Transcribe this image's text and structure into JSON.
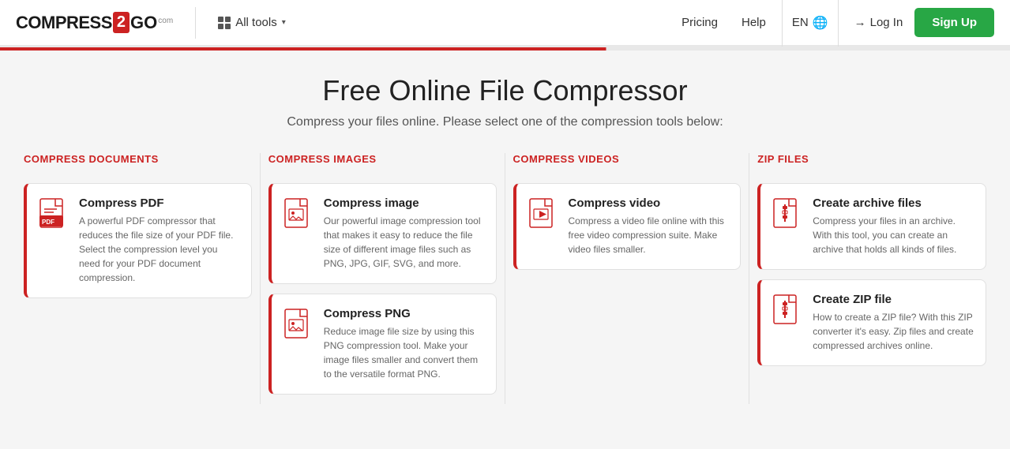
{
  "header": {
    "logo": {
      "part1": "COMPRESS",
      "part2": "2",
      "part3": "GO",
      "suffix": "com"
    },
    "allTools": "All tools",
    "nav": {
      "pricing": "Pricing",
      "help": "Help",
      "lang": "EN",
      "login": "Log In",
      "signup": "Sign Up"
    }
  },
  "page": {
    "title": "Free Online File Compressor",
    "subtitle": "Compress your files online. Please select one of the compression tools below:"
  },
  "columns": [
    {
      "header": "COMPRESS DOCUMENTS",
      "tools": [
        {
          "title": "Compress PDF",
          "desc": "A powerful PDF compressor that reduces the file size of your PDF file. Select the compression level you need for your PDF document compression.",
          "iconType": "pdf"
        }
      ]
    },
    {
      "header": "COMPRESS IMAGES",
      "tools": [
        {
          "title": "Compress image",
          "desc": "Our powerful image compression tool that makes it easy to reduce the file size of different image files such as PNG, JPG, GIF, SVG, and more.",
          "iconType": "img"
        },
        {
          "title": "Compress PNG",
          "desc": "Reduce image file size by using this PNG compression tool. Make your image files smaller and convert them to the versatile format PNG.",
          "iconType": "img"
        }
      ]
    },
    {
      "header": "COMPRESS VIDEOS",
      "tools": [
        {
          "title": "Compress video",
          "desc": "Compress a video file online with this free video compression suite. Make video files smaller.",
          "iconType": "vid"
        }
      ]
    },
    {
      "header": "ZIP FILES",
      "tools": [
        {
          "title": "Create archive files",
          "desc": "Compress your files in an archive. With this tool, you can create an archive that holds all kinds of files.",
          "iconType": "zip"
        },
        {
          "title": "Create ZIP file",
          "desc": "How to create a ZIP file? With this ZIP converter it's easy. Zip files and create compressed archives online.",
          "iconType": "zip"
        }
      ]
    }
  ],
  "colors": {
    "red": "#cc2222",
    "green": "#28a745"
  }
}
